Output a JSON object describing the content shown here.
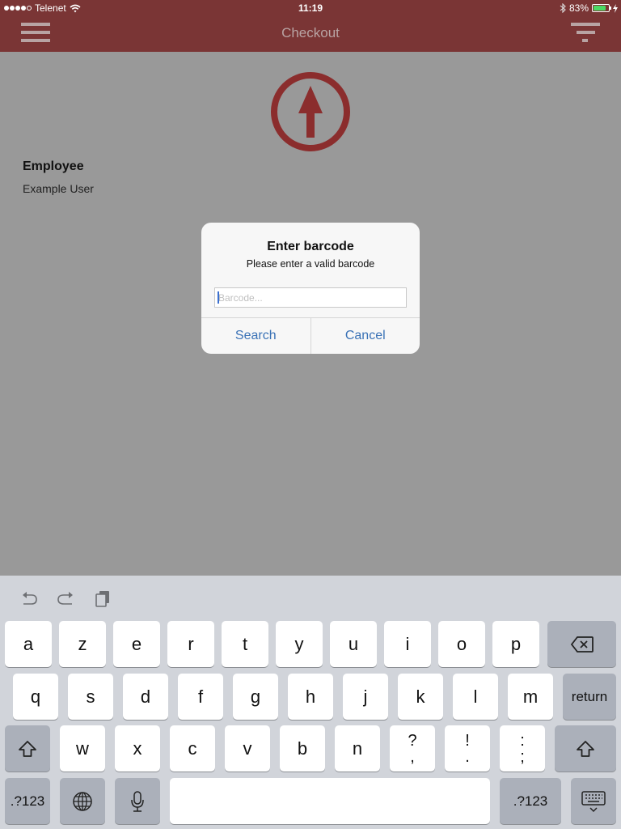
{
  "status_bar": {
    "carrier": "Telenet",
    "time": "11:19",
    "battery_percent": "83%",
    "battery_level": 0.83,
    "signal_bars_filled": 4,
    "signal_bars_total": 5
  },
  "nav": {
    "title": "Checkout",
    "left_icon": "hamburger-menu-icon",
    "right_icon": "filter-icon"
  },
  "content": {
    "main_icon": "upload-arrow-circle-icon",
    "employee_label": "Employee",
    "employee_value": "Example User"
  },
  "alert": {
    "title": "Enter barcode",
    "message": "Please enter a valid barcode",
    "input_value": "",
    "input_placeholder": "Barcode...",
    "buttons": [
      "Search",
      "Cancel"
    ]
  },
  "keyboard": {
    "toolbar": [
      "undo-icon",
      "redo-icon",
      "paste-icon"
    ],
    "row1": [
      "a",
      "z",
      "e",
      "r",
      "t",
      "y",
      "u",
      "i",
      "o",
      "p"
    ],
    "row2": [
      "q",
      "s",
      "d",
      "f",
      "g",
      "h",
      "j",
      "k",
      "l",
      "m"
    ],
    "row3": [
      "w",
      "x",
      "c",
      "v",
      "b",
      "n"
    ],
    "row3_punct": [
      {
        "top": "?",
        "bottom": ","
      },
      {
        "top": "!",
        "bottom": "."
      },
      {
        "top": ":",
        "bottom": ";"
      }
    ],
    "return_label": "return",
    "numbers_label": ".?123"
  },
  "colors": {
    "brand": "#7a3535",
    "nav_text": "#b8a3a3",
    "icon": "#8b2d2d",
    "link": "#3a72b6",
    "dimmed_bg": "#999999"
  }
}
